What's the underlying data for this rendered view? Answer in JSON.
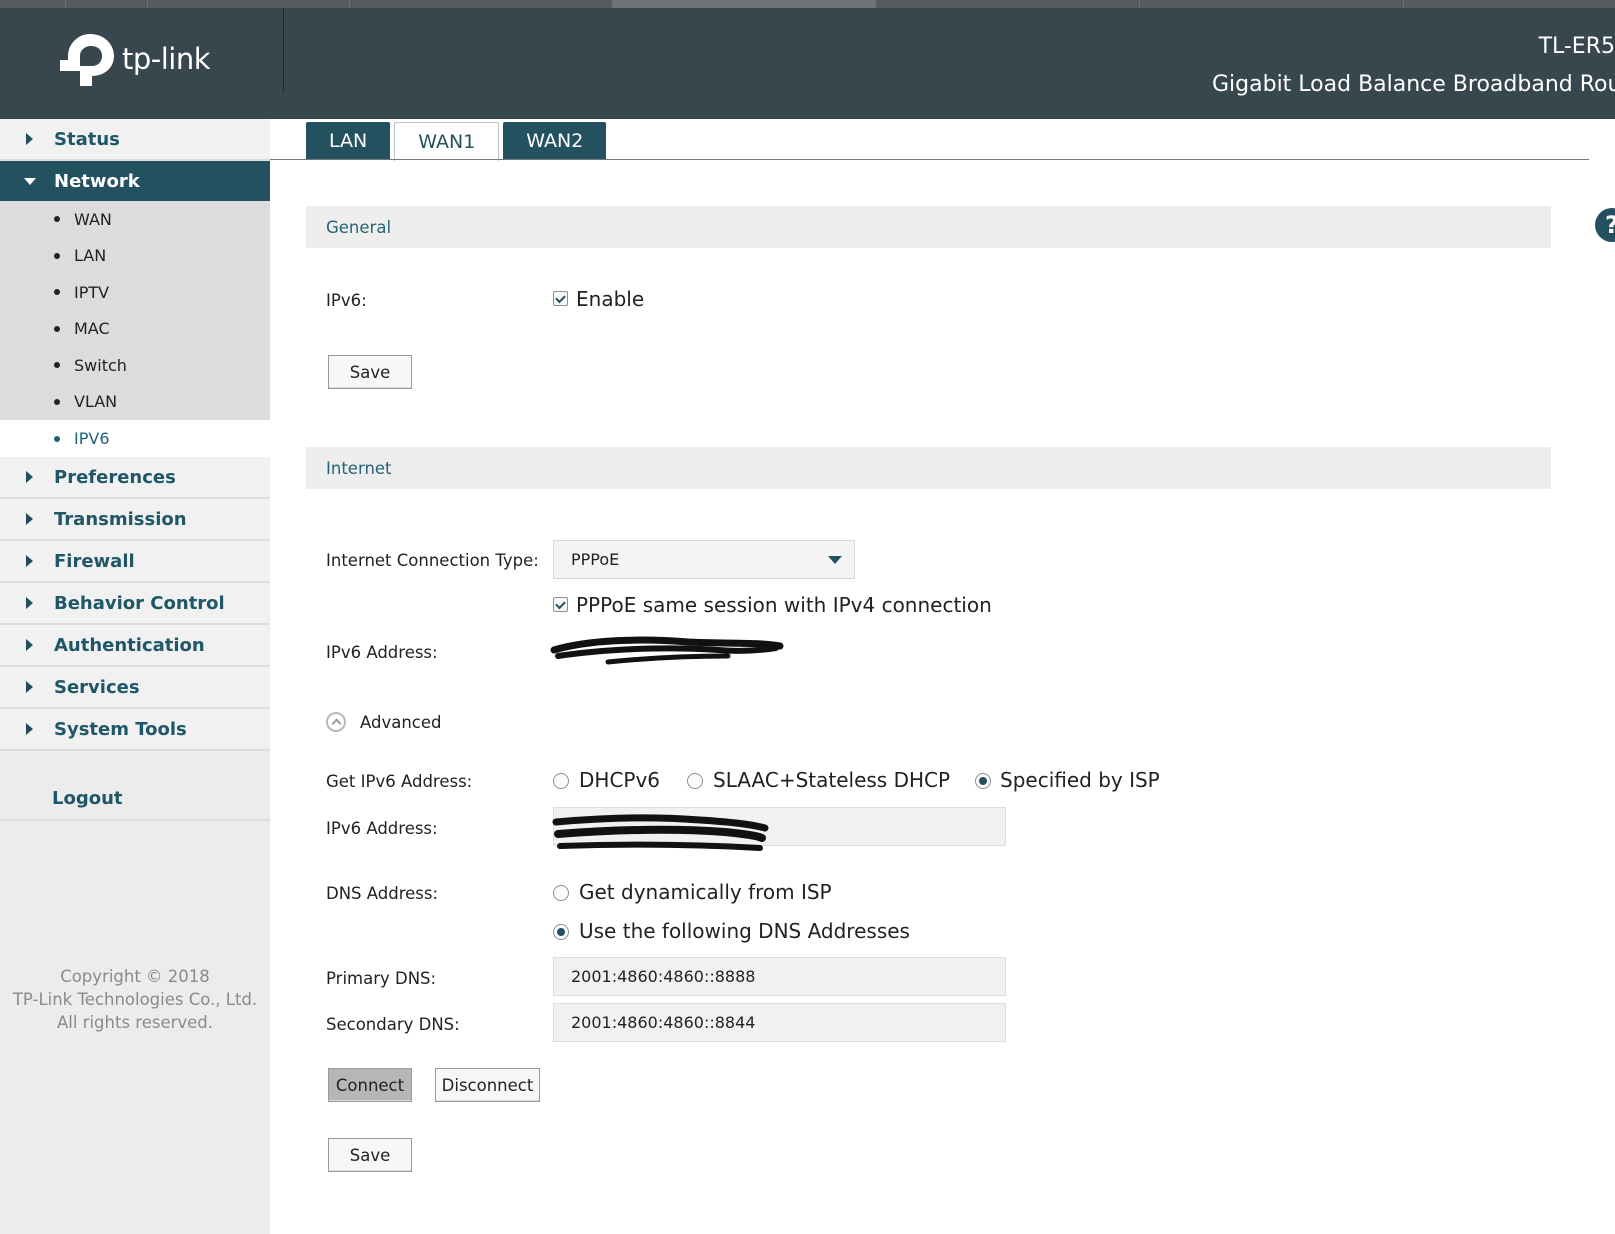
{
  "header": {
    "brand": "tp-link",
    "model": "TL-ER5",
    "description": "Gigabit Load Balance Broadband Rou"
  },
  "sidebar": {
    "items": [
      {
        "label": "Status"
      },
      {
        "label": "Network"
      },
      {
        "label": "Preferences"
      },
      {
        "label": "Transmission"
      },
      {
        "label": "Firewall"
      },
      {
        "label": "Behavior Control"
      },
      {
        "label": "Authentication"
      },
      {
        "label": "Services"
      },
      {
        "label": "System Tools"
      }
    ],
    "network_subitems": [
      "WAN",
      "LAN",
      "IPTV",
      "MAC",
      "Switch",
      "VLAN",
      "IPV6"
    ],
    "active_subitem": "IPV6",
    "logout": "Logout",
    "copyright": [
      "Copyright © 2018",
      "TP-Link Technologies Co., Ltd.",
      "All rights reserved."
    ]
  },
  "tabs": [
    {
      "label": "LAN",
      "active": false
    },
    {
      "label": "WAN1",
      "active": true
    },
    {
      "label": "WAN2",
      "active": false
    }
  ],
  "help_icon": "?",
  "general": {
    "title": "General",
    "ipv6_label": "IPv6:",
    "enable_label": "Enable",
    "enable_checked": true,
    "save_label": "Save"
  },
  "internet": {
    "title": "Internet",
    "connection_type_label": "Internet Connection Type:",
    "connection_type_value": "PPPoE",
    "same_session_label": "PPPoE same session with IPv4 connection",
    "same_session_checked": true,
    "ipv6_address_label": "IPv6 Address:",
    "advanced_label": "Advanced",
    "get_ipv6_label": "Get IPv6 Address:",
    "get_ipv6_options": [
      "DHCPv6",
      "SLAAC+Stateless DHCP",
      "Specified by ISP"
    ],
    "get_ipv6_selected": "Specified by ISP",
    "ipv6_address2_label": "IPv6 Address:",
    "dns_label": "DNS Address:",
    "dns_options": [
      "Get dynamically from ISP",
      "Use the following DNS Addresses"
    ],
    "dns_selected": "Use the following DNS Addresses",
    "primary_dns_label": "Primary DNS:",
    "primary_dns_value": "2001:4860:4860::8888",
    "secondary_dns_label": "Secondary DNS:",
    "secondary_dns_value": "2001:4860:4860::8844",
    "connect_label": "Connect",
    "disconnect_label": "Disconnect",
    "save_label": "Save"
  },
  "colors": {
    "header_bg": "#37474d",
    "accent": "#24515f",
    "section_text": "#256376"
  },
  "icons": {
    "logo": "tp-link-logo-icon",
    "collapsed": "caret-right-icon",
    "expanded": "caret-down-icon",
    "help": "help-icon",
    "advanced": "chevron-up-circle-icon",
    "dropdown": "dropdown-caret-icon"
  }
}
